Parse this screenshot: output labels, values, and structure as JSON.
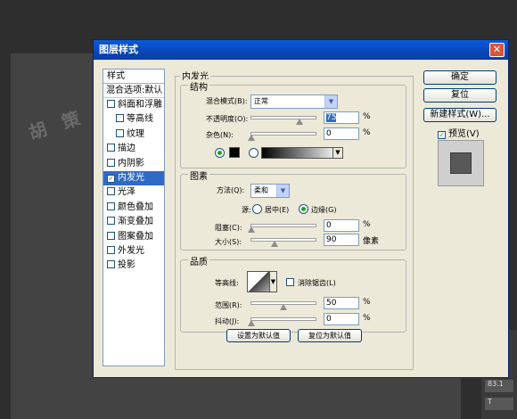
{
  "canvas": {
    "watermark": "胡 策 大"
  },
  "side_tools": [
    "83.1",
    "T"
  ],
  "dialog": {
    "title": "图层样式",
    "close": "✕"
  },
  "styles_list": {
    "header": "样式",
    "blend": "混合选项:默认",
    "items": [
      {
        "label": "斜面和浮雕",
        "checked": false,
        "indent": false
      },
      {
        "label": "等高线",
        "checked": false,
        "indent": true
      },
      {
        "label": "纹理",
        "checked": false,
        "indent": true
      },
      {
        "label": "描边",
        "checked": false,
        "indent": false
      },
      {
        "label": "内阴影",
        "checked": false,
        "indent": false
      },
      {
        "label": "内发光",
        "checked": true,
        "indent": false,
        "selected": true
      },
      {
        "label": "光泽",
        "checked": false,
        "indent": false
      },
      {
        "label": "颜色叠加",
        "checked": false,
        "indent": false
      },
      {
        "label": "渐变叠加",
        "checked": false,
        "indent": false
      },
      {
        "label": "图案叠加",
        "checked": false,
        "indent": false
      },
      {
        "label": "外发光",
        "checked": false,
        "indent": false
      },
      {
        "label": "投影",
        "checked": false,
        "indent": false
      }
    ]
  },
  "inner_glow": {
    "title": "内发光",
    "structure": {
      "title": "结构",
      "blend_mode_label": "混合模式(B):",
      "blend_mode_value": "正常",
      "opacity_label": "不透明度(O):",
      "opacity_value": "75",
      "opacity_pct": 75,
      "noise_label": "杂色(N):",
      "noise_value": "0",
      "noise_pct": 0,
      "unit": "%"
    },
    "elements": {
      "title": "图素",
      "method_label": "方法(Q):",
      "method_value": "柔和",
      "source_label": "源:",
      "center_label": "居中(E)",
      "edge_label": "边缘(G)",
      "choke_label": "阻塞(C):",
      "choke_value": "0",
      "choke_pct": 0,
      "size_label": "大小(S):",
      "size_value": "90",
      "size_pct": 36,
      "unit_pct": "%",
      "unit_px": "像素"
    },
    "quality": {
      "title": "品质",
      "contour_label": "等高线:",
      "antialias_label": "消除锯齿(L)",
      "range_label": "范围(R):",
      "range_value": "50",
      "range_pct": 50,
      "jitter_label": "抖动(J):",
      "jitter_value": "0",
      "jitter_pct": 0,
      "unit": "%"
    },
    "make_default": "设置为默认值",
    "reset_default": "复位为默认值"
  },
  "buttons": {
    "ok": "确定",
    "reset": "复位",
    "new_style": "新建样式(W)...",
    "preview": "预览(V)"
  }
}
